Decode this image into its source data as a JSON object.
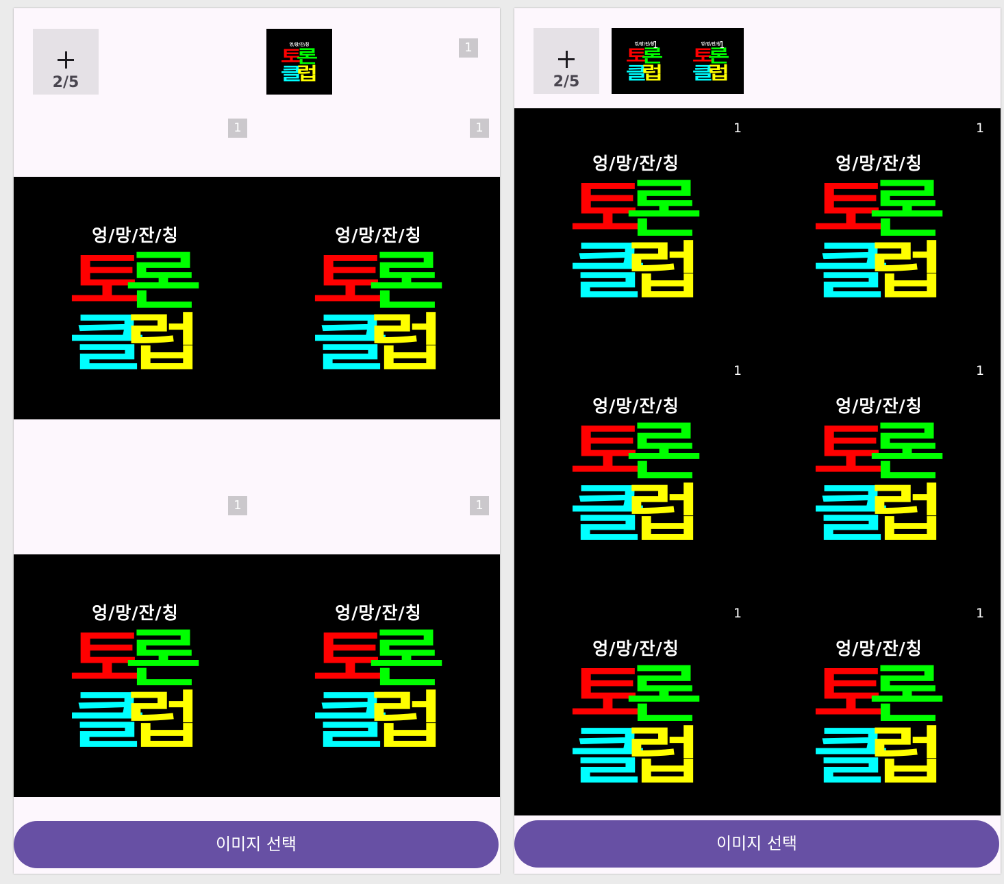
{
  "logo": {
    "subtitle": "엉/망/잔/칭",
    "char1": "토",
    "char2": "론",
    "char3": "클",
    "char4": "럽",
    "colors": {
      "char1": "#ff0000",
      "char2": "#00ff00",
      "char3": "#00ffff",
      "char4": "#ffff00"
    }
  },
  "left_panel": {
    "add_button": {
      "icon": "plus-icon",
      "count": "2/5"
    },
    "thumb_badge": "1",
    "row_badges": [
      "1",
      "1",
      "1",
      "1"
    ],
    "select_button_label": "이미지 선택"
  },
  "right_panel": {
    "add_button": {
      "icon": "plus-icon",
      "count": "2/5"
    },
    "thumb_badges": [
      "1",
      "1"
    ],
    "cell_badges": [
      "1",
      "1",
      "1",
      "1",
      "1",
      "1"
    ],
    "select_button_label": "이미지 선택"
  },
  "theme": {
    "accent": "#6750a4",
    "panel_bg": "#fdf7fd",
    "badge_bg": "#cbc8cc"
  }
}
